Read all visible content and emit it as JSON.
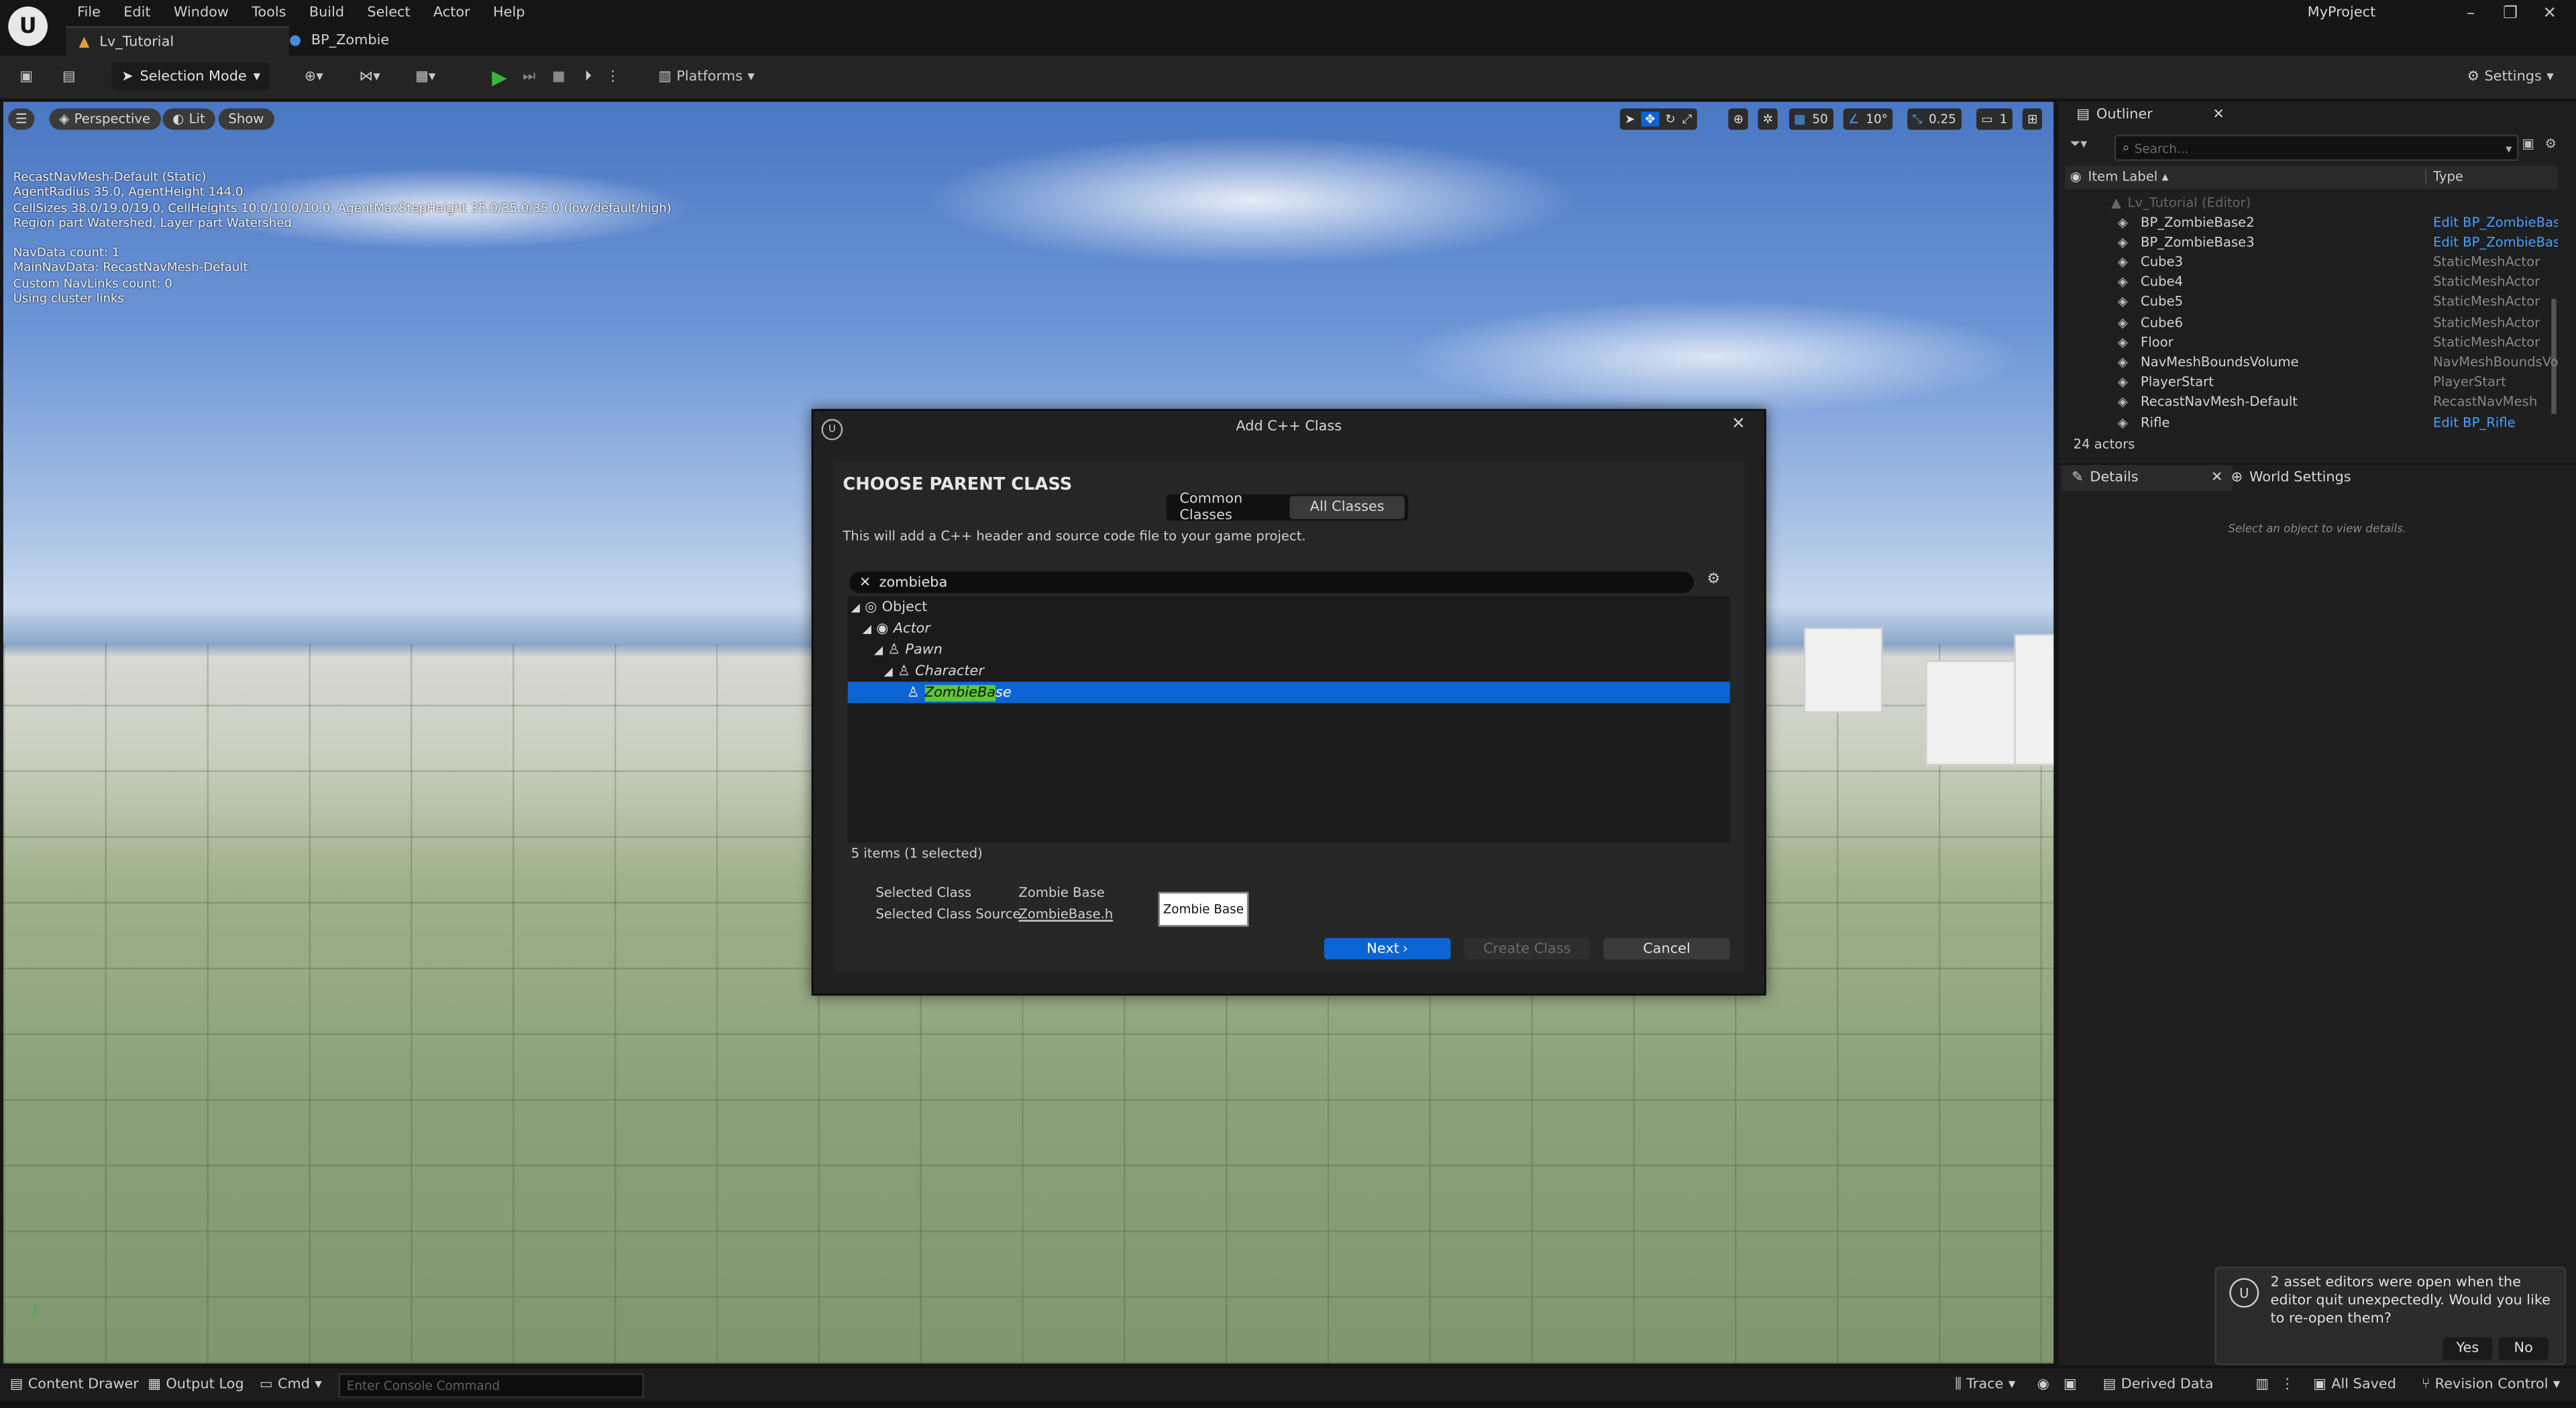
{
  "title_bar": {
    "menu": [
      "File",
      "Edit",
      "Window",
      "Tools",
      "Build",
      "Select",
      "Actor",
      "Help"
    ],
    "tabs": [
      "Lv_Tutorial",
      "BP_Zombie"
    ],
    "project": "MyProject"
  },
  "toolbar": {
    "selection_mode": "Selection Mode",
    "platforms": "Platforms",
    "settings": "Settings"
  },
  "viewport": {
    "perspective": "Perspective",
    "lit": "Lit",
    "show": "Show",
    "snap_grid": "50",
    "snap_angle": "10°",
    "snap_scale": "0.25",
    "camera_speed": "1",
    "stats": [
      "RecastNavMesh-Default (Static)",
      "AgentRadius 35.0, AgentHeight 144.0",
      "CellSizes 38.0/19.0/19.0, CellHeights 10.0/10.0/10.0, AgentMaxStepHeight 35.0/35.0/35.0 (low/default/high)",
      "Region part Watershed, Layer part Watershed",
      "",
      "NavData count: 1",
      "MainNavData: RecastNavMesh-Default",
      "Custom NavLinks count: 0",
      "Using cluster links"
    ]
  },
  "dialog": {
    "title": "Add C++ Class",
    "heading": "CHOOSE PARENT CLASS",
    "tab_common": "Common Classes",
    "tab_all": "All Classes",
    "description": "This will add a C++ header and source code file to your game project.",
    "search_value": "zombieba",
    "tree": [
      "Object",
      "Actor",
      "Pawn",
      "Character",
      "ZombieBase"
    ],
    "match_highlight": "ZombieBa",
    "match_rest": "se",
    "tooltip": "Zombie Base",
    "items_count": "5 items (1 selected)",
    "selected_class_label": "Selected Class",
    "selected_class_value": "Zombie Base",
    "selected_source_label": "Selected Class Source",
    "selected_source_value": "ZombieBase.h",
    "next": "Next",
    "create": "Create Class",
    "cancel": "Cancel"
  },
  "outliner": {
    "tab": "Outliner",
    "search_placeholder": "Search...",
    "col_label": "Item Label",
    "col_type": "Type",
    "root": "Lv_Tutorial (Editor)",
    "rows": [
      {
        "label": "BP_ZombieBase2",
        "type": "Edit BP_ZombieBase",
        "link": true
      },
      {
        "label": "BP_ZombieBase3",
        "type": "Edit BP_ZombieBase",
        "link": true
      },
      {
        "label": "Cube3",
        "type": "StaticMeshActor",
        "link": false
      },
      {
        "label": "Cube4",
        "type": "StaticMeshActor",
        "link": false
      },
      {
        "label": "Cube5",
        "type": "StaticMeshActor",
        "link": false
      },
      {
        "label": "Cube6",
        "type": "StaticMeshActor",
        "link": false
      },
      {
        "label": "Floor",
        "type": "StaticMeshActor",
        "link": false
      },
      {
        "label": "NavMeshBoundsVolume",
        "type": "NavMeshBoundsVolu",
        "link": false
      },
      {
        "label": "PlayerStart",
        "type": "PlayerStart",
        "link": false
      },
      {
        "label": "RecastNavMesh-Default",
        "type": "RecastNavMesh",
        "link": false
      },
      {
        "label": "Rifle",
        "type": "Edit BP_Rifle",
        "link": true
      }
    ],
    "actor_count": "24 actors"
  },
  "details": {
    "tab": "Details",
    "world_settings": "World Settings",
    "empty_text": "Select an object to view details."
  },
  "statusbar": {
    "content_drawer": "Content Drawer",
    "output_log": "Output Log",
    "cmd": "Cmd",
    "console_placeholder": "Enter Console Command",
    "trace": "Trace",
    "derived_data": "Derived Data",
    "all_saved": "All Saved",
    "revision_control": "Revision Control"
  },
  "toast": {
    "message": "2 asset editors were open when the editor quit unexpectedly. Would you like to re-open them?",
    "yes": "Yes",
    "no": "No"
  },
  "colors": {
    "accent": "#0a64d6",
    "link": "#4aa0ff",
    "play_green": "#35b835"
  }
}
